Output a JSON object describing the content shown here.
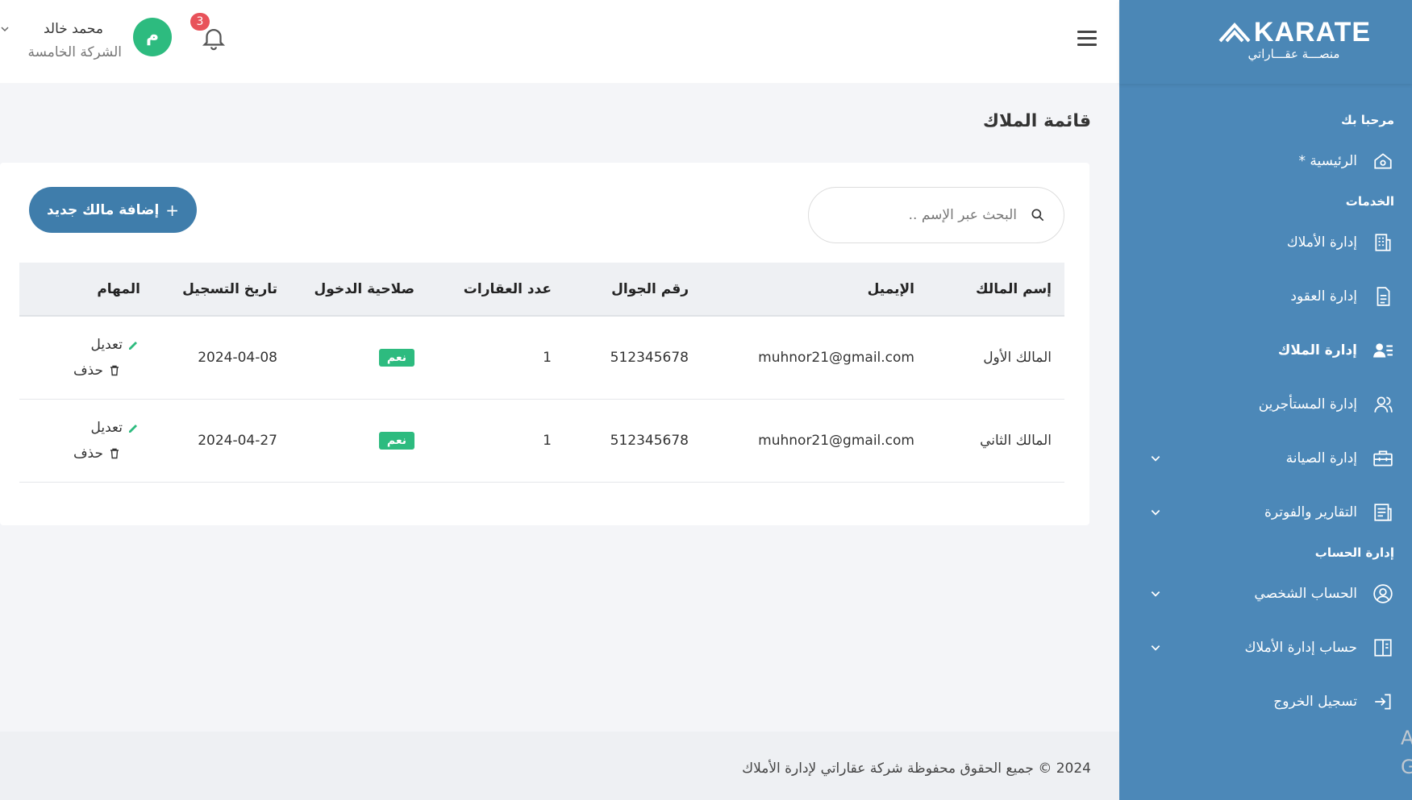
{
  "brand": {
    "logo_text": "KARATE",
    "logo_sub": "منصـــة عقـــاراتي"
  },
  "sidebar": {
    "welcome": "مرحبا بك",
    "home": "الرئيسية *",
    "services_title": "الخدمات",
    "items": [
      {
        "label": "إدارة الأملاك"
      },
      {
        "label": "إدارة العقود"
      },
      {
        "label": "إدارة الملاك"
      },
      {
        "label": "إدارة المستأجرين"
      },
      {
        "label": "إدارة الصيانة"
      },
      {
        "label": "التقارير والفوترة"
      }
    ],
    "account_title": "إدارة الحساب",
    "account_items": [
      {
        "label": "الحساب الشخصي"
      },
      {
        "label": "حساب إدارة الأملاك"
      },
      {
        "label": "تسجيل الخروج"
      }
    ]
  },
  "header": {
    "notifications_count": "3",
    "avatar_letter": "م",
    "user_name": "محمد خالد",
    "company": "الشركة الخامسة"
  },
  "page": {
    "title": "قائمة الملاك",
    "search_placeholder": "البحث عبر الإسم ..",
    "add_button": "إضافة مالك جديد"
  },
  "table": {
    "headers": [
      "إسم المالك",
      "الإيميل",
      "رقم الجوال",
      "عدد العقارات",
      "صلاحية الدخول",
      "تاريخ التسجيل",
      "المهام"
    ],
    "rows": [
      {
        "name": "المالك الأول",
        "email": "muhnor21@gmail.com",
        "phone": "512345678",
        "count": "1",
        "access": "نعم",
        "date": "2024-04-08"
      },
      {
        "name": "المالك الثاني",
        "email": "muhnor21@gmail.com",
        "phone": "512345678",
        "count": "1",
        "access": "نعم",
        "date": "2024-04-27"
      }
    ],
    "edit_label": "تعديل",
    "delete_label": "حذف"
  },
  "footer": {
    "text": "2024 © جميع الحقوق محفوظة شركة عقاراتي لإدارة الأملاك"
  },
  "edge": {
    "letters": [
      "A",
      "G"
    ]
  },
  "colors": {
    "sidebar": "#4c88b8",
    "accent_button": "#3f7dab",
    "success": "#2dbb7f",
    "badge_red": "#e8525a"
  }
}
